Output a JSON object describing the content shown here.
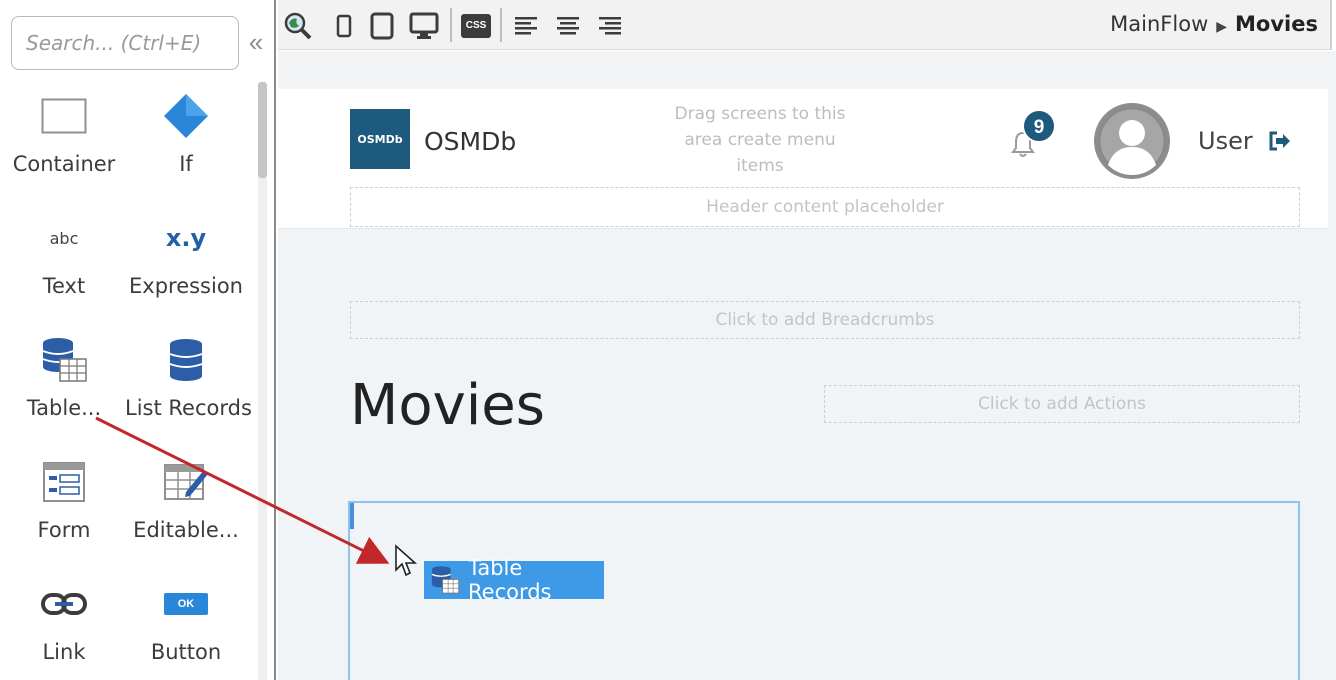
{
  "toolbox": {
    "search_placeholder": "Search... (Ctrl+E)",
    "collapse_icon": "«",
    "items": [
      {
        "label": "Container",
        "icon": "container-icon"
      },
      {
        "label": "If",
        "icon": "if-diamond-icon"
      },
      {
        "label": "Text",
        "icon": "text-abc-icon",
        "icon_text": "abc"
      },
      {
        "label": "Expression",
        "icon": "expression-icon",
        "icon_text": "x.y"
      },
      {
        "label": "Table...",
        "icon": "table-records-icon"
      },
      {
        "label": "List Records",
        "icon": "list-records-icon"
      },
      {
        "label": "Form",
        "icon": "form-icon"
      },
      {
        "label": "Editable...",
        "icon": "editable-table-icon"
      },
      {
        "label": "Link",
        "icon": "link-icon"
      },
      {
        "label": "Button",
        "icon": "button-icon",
        "icon_text": "OK"
      }
    ]
  },
  "topbar": {
    "breadcrumb_parent": "MainFlow",
    "breadcrumb_current": "Movies",
    "css_label": "CSS"
  },
  "app_header": {
    "logo_text": "OSMDb",
    "app_name": "OSMDb",
    "menu_hint": "Drag screens to this area create menu items",
    "notification_count": "9",
    "user_name": "User",
    "header_placeholder": "Header content placeholder"
  },
  "page": {
    "breadcrumbs_placeholder": "Click to add Breadcrumbs",
    "title": "Movies",
    "actions_placeholder": "Click to add Actions",
    "dragged_widget": "Table Records"
  },
  "colors": {
    "brand": "#1e5a7e",
    "drag_chip": "#3e9ae6",
    "arrow": "#c0282c"
  }
}
